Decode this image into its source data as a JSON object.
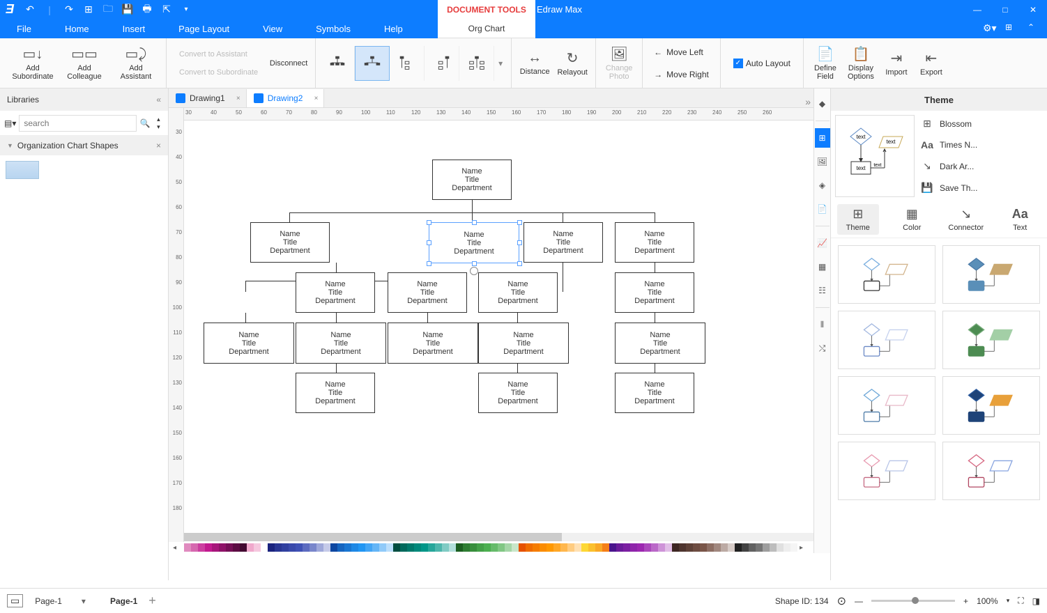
{
  "app_name": "Edraw Max",
  "doc_tools_label": "DOCUMENT TOOLS",
  "menu": [
    "File",
    "Home",
    "Insert",
    "Page Layout",
    "View",
    "Symbols",
    "Help"
  ],
  "org_chart_tab": "Org Chart",
  "ribbon": {
    "add_subordinate": "Add\nSubordinate",
    "add_colleague": "Add\nColleague",
    "add_assistant": "Add\nAssistant",
    "convert_assistant": "Convert to Assistant",
    "convert_subordinate": "Convert to Subordinate",
    "disconnect": "Disconnect",
    "distance": "Distance",
    "relayout": "Relayout",
    "change_photo": "Change\nPhoto",
    "move_left": "Move Left",
    "move_right": "Move Right",
    "auto_layout": "Auto Layout",
    "define_field": "Define\nField",
    "display_options": "Display\nOptions",
    "import": "Import",
    "export": "Export"
  },
  "libraries": {
    "title": "Libraries",
    "search_placeholder": "search",
    "accordion": "Organization Chart Shapes"
  },
  "tabs": [
    {
      "label": "Drawing1",
      "active": false
    },
    {
      "label": "Drawing2",
      "active": true
    }
  ],
  "ruler_h_ticks": [
    "30",
    "40",
    "50",
    "60",
    "70",
    "80",
    "90",
    "100",
    "110",
    "120",
    "130",
    "140",
    "150",
    "160",
    "170",
    "180",
    "190",
    "200",
    "210",
    "220",
    "230",
    "240",
    "250",
    "260"
  ],
  "ruler_v_ticks": [
    "30",
    "40",
    "50",
    "60",
    "70",
    "80",
    "90",
    "100",
    "110",
    "120",
    "130",
    "140",
    "150",
    "160",
    "170",
    "180"
  ],
  "org_node": {
    "name": "Name",
    "title": "Title",
    "dept": "Department"
  },
  "theme_panel": {
    "title": "Theme",
    "props": [
      {
        "icon": "⊞",
        "label": "Blossom"
      },
      {
        "icon": "Aa",
        "label": "Times N..."
      },
      {
        "icon": "↘",
        "label": "Dark Ar..."
      },
      {
        "icon": "💾",
        "label": "Save Th..."
      }
    ],
    "tabs": [
      "Theme",
      "Color",
      "Connector",
      "Text"
    ]
  },
  "statusbar": {
    "page_selector": "Page-1",
    "page_label": "Page-1",
    "shape_id": "Shape ID: 134",
    "zoom": "100%"
  },
  "palette_colors": [
    "#e08bbf",
    "#d668af",
    "#cc3ea0",
    "#c2198f",
    "#a7157b",
    "#8e1268",
    "#750f56",
    "#5c0c43",
    "#430931",
    "#f0a8cc",
    "#f5c7de",
    "#fff",
    "#1a237e",
    "#283593",
    "#303f9f",
    "#3949ab",
    "#3f51b5",
    "#5c6bc0",
    "#7986cb",
    "#9fa8da",
    "#c5cae9",
    "#0d47a1",
    "#1565c0",
    "#1976d2",
    "#1e88e5",
    "#2196f3",
    "#42a5f5",
    "#64b5f6",
    "#90caf9",
    "#bbdefb",
    "#004d40",
    "#00695c",
    "#00796b",
    "#00897b",
    "#009688",
    "#26a69a",
    "#4db6ac",
    "#80cbc4",
    "#b2dfdb",
    "#1b5e20",
    "#2e7d32",
    "#388e3c",
    "#43a047",
    "#4caf50",
    "#66bb6a",
    "#81c784",
    "#a5d6a7",
    "#c8e6c9",
    "#e65100",
    "#ef6c00",
    "#f57c00",
    "#fb8c00",
    "#ff9800",
    "#ffa726",
    "#ffb74d",
    "#ffcc80",
    "#ffe0b2",
    "#fdd835",
    "#fbc02d",
    "#f9a825",
    "#f57f17",
    "#4a148c",
    "#6a1b9a",
    "#7b1fa2",
    "#8e24aa",
    "#9c27b0",
    "#ab47bc",
    "#ba68c8",
    "#ce93d8",
    "#e1bee7",
    "#3e2723",
    "#4e342e",
    "#5d4037",
    "#6d4c41",
    "#795548",
    "#8d6e63",
    "#a1887f",
    "#bcaaa4",
    "#d7ccc8",
    "#212121",
    "#424242",
    "#616161",
    "#757575",
    "#9e9e9e",
    "#bdbdbd",
    "#e0e0e0",
    "#eeeeee",
    "#f5f5f5"
  ]
}
